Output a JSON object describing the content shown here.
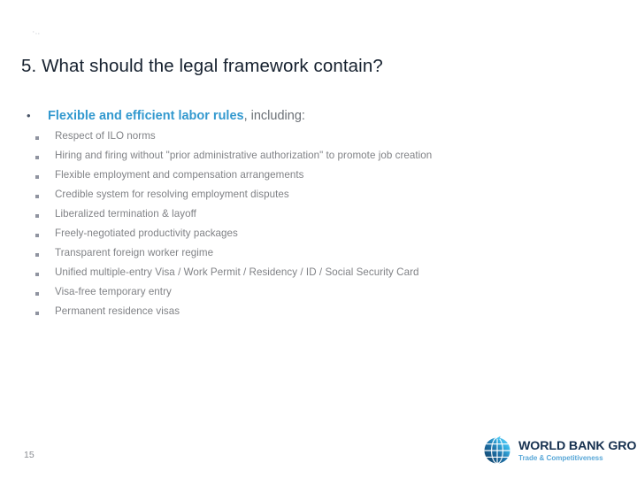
{
  "slide": {
    "number": "15",
    "title": "5. What should the legal framework contain?",
    "artifact_glyph": "·..",
    "background_color": "#ffffff"
  },
  "colors": {
    "title": "#15202e",
    "accent_blue": "#3399cf",
    "body_gray": "#808286",
    "tail_gray": "#6b7076",
    "logo_navy": "#16304f",
    "logo_blue": "#5aa8d8"
  },
  "content": {
    "main_bullet": {
      "marker": "bullet-dot",
      "highlight": "Flexible and efficient labor rules",
      "tail": ", including:"
    },
    "sub_bullets": [
      "Respect of ILO norms",
      "Hiring and firing without \"prior administrative authorization\" to promote job creation",
      "Flexible employment and compensation arrangements",
      "Credible system for resolving employment disputes",
      "Liberalized termination & layoff",
      "Freely-negotiated productivity packages",
      "Transparent foreign worker regime",
      "Unified multiple-entry Visa / Work Permit / Residency / ID / Social Security Card",
      "Visa-free temporary entry",
      "Permanent residence visas"
    ]
  },
  "logo": {
    "icon": "globe-icon",
    "name": "WORLD BANK GROUP",
    "tagline": "Trade & Competitiveness"
  }
}
